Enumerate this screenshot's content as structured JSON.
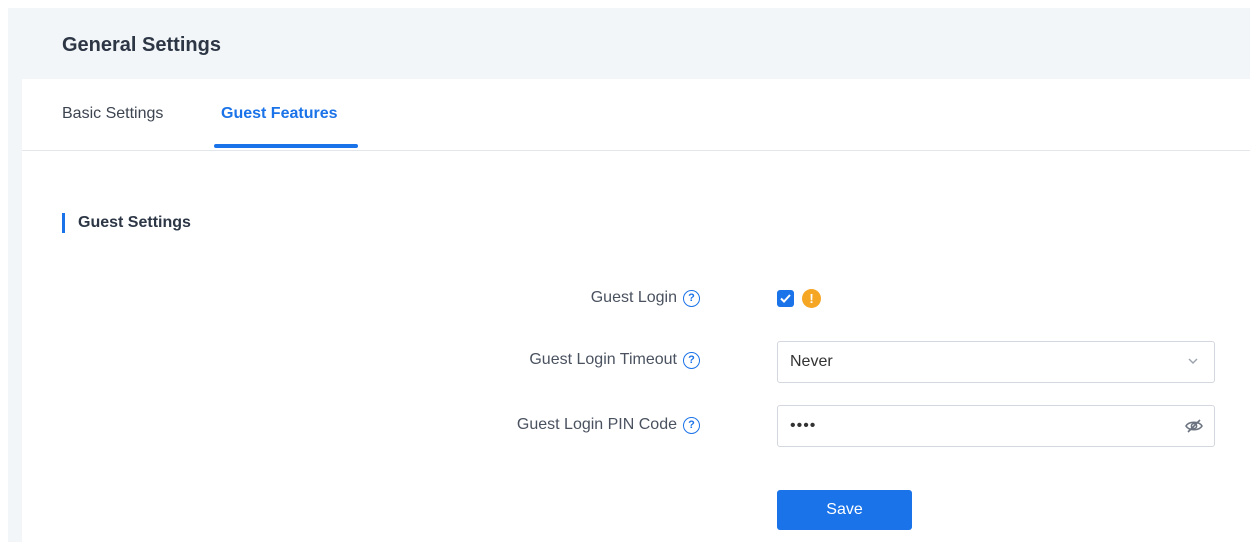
{
  "header": {
    "title": "General Settings"
  },
  "tabs": [
    {
      "label": "Basic Settings",
      "active": false
    },
    {
      "label": "Guest Features",
      "active": true
    }
  ],
  "section": {
    "title": "Guest Settings"
  },
  "form": {
    "guest_login": {
      "label": "Guest Login",
      "checked": true,
      "help_icon": "question-circle-icon",
      "status_icon": "warning-icon"
    },
    "guest_login_timeout": {
      "label": "Guest Login Timeout",
      "value": "Never",
      "help_icon": "question-circle-icon"
    },
    "guest_login_pin": {
      "label": "Guest Login PIN Code",
      "value": "••••",
      "help_icon": "question-circle-icon",
      "toggle_icon": "eye-off-icon"
    }
  },
  "actions": {
    "save_label": "Save"
  },
  "colors": {
    "accent": "#1a73e8",
    "warning": "#f5a623",
    "background": "#f3f6f8"
  }
}
